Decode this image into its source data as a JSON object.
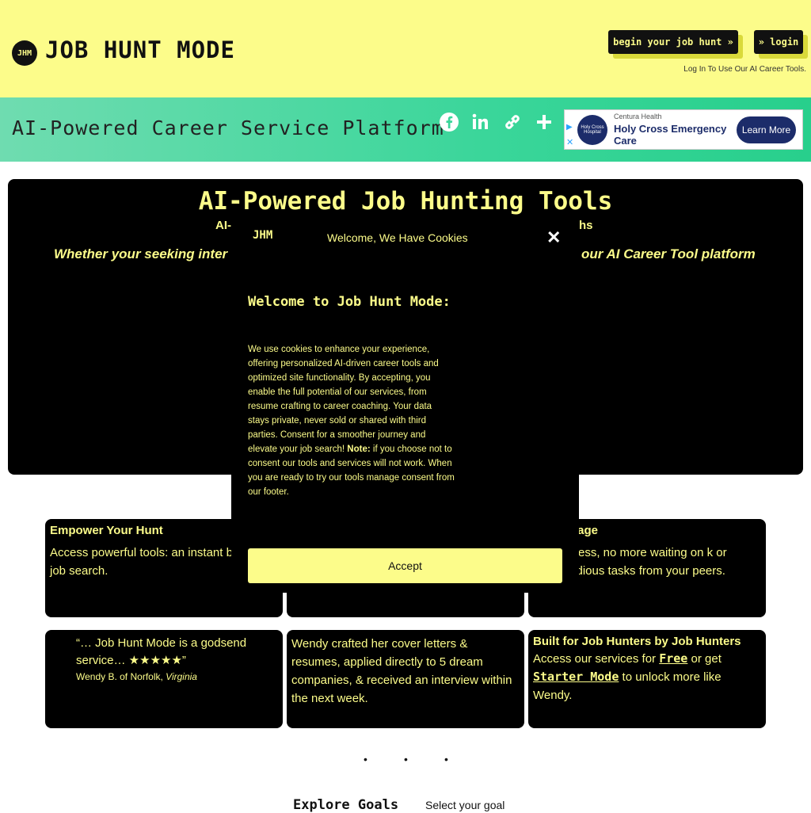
{
  "header": {
    "logo_text": "JHM",
    "brand": "JOB HUNT MODE",
    "hunt_button": "begin your job hunt »",
    "login_button": "» login",
    "login_note": "Log In To Use Our AI Career Tools."
  },
  "banner": {
    "tagline": "AI-Powered Career Service Platform",
    "share_icons": [
      "facebook-icon",
      "linkedin-icon",
      "link-icon",
      "plus-icon"
    ],
    "ad": {
      "logo_text": "Holy Cross Hospital",
      "source": "Centura Health",
      "title": "Holy Cross Emergency Care",
      "button": "Learn More"
    }
  },
  "hero": {
    "title": "AI-Powered Job Hunting Tools",
    "subtitle_left": "AI-",
    "subtitle_right": "ths",
    "line_left": "Whether your seeking inter",
    "line_right": "our AI Career Tool platform"
  },
  "cards": {
    "a1": {
      "title": "Empower Your Hunt",
      "text": "Access powerful tools: an instant b your job search."
    },
    "a3": {
      "title": "ntage",
      "text": "ccess, no more waiting on k or tedious tasks from your peers."
    },
    "b1": {
      "quote": "“… Job Hunt Mode is a godsend service… ★★★★★”",
      "by": "Wendy B. of Norfolk, ",
      "by_state": "Virginia"
    },
    "b2": {
      "text": "Wendy crafted her cover letters & resumes, applied directly to 5 dream companies, & received an interview within the next week."
    },
    "b3": {
      "title": "Built for Job Hunters by Job Hunters",
      "pre": "Access our services for ",
      "free": "Free",
      "mid": " or get ",
      "starter": "Starter Mode",
      "post": " to unlock more like Wendy."
    }
  },
  "bottom": {
    "goals_label": "Explore Goals",
    "goal_select": "Select your goal"
  },
  "modal": {
    "logo": "JHM",
    "heading": "Welcome, We Have Cookies",
    "title": "Welcome to Job Hunt Mode:",
    "body": "We use cookies to enhance your experience, offering personalized AI-driven career tools and optimized site functionality. By accepting, you enable the full potential of our services, from resume crafting to career coaching. Your data stays private, never sold or shared with third parties. Consent for a smoother journey and elevate your job search! ",
    "note_label": "Note:",
    "note_text": " if you choose not to consent our tools and services will not work. When you are ready to try our tools manage consent from our footer.",
    "accept": "Accept"
  },
  "colors": {
    "accent": "#fcfc8a",
    "dark": "#000000",
    "banner_green": "#3ad69a"
  }
}
